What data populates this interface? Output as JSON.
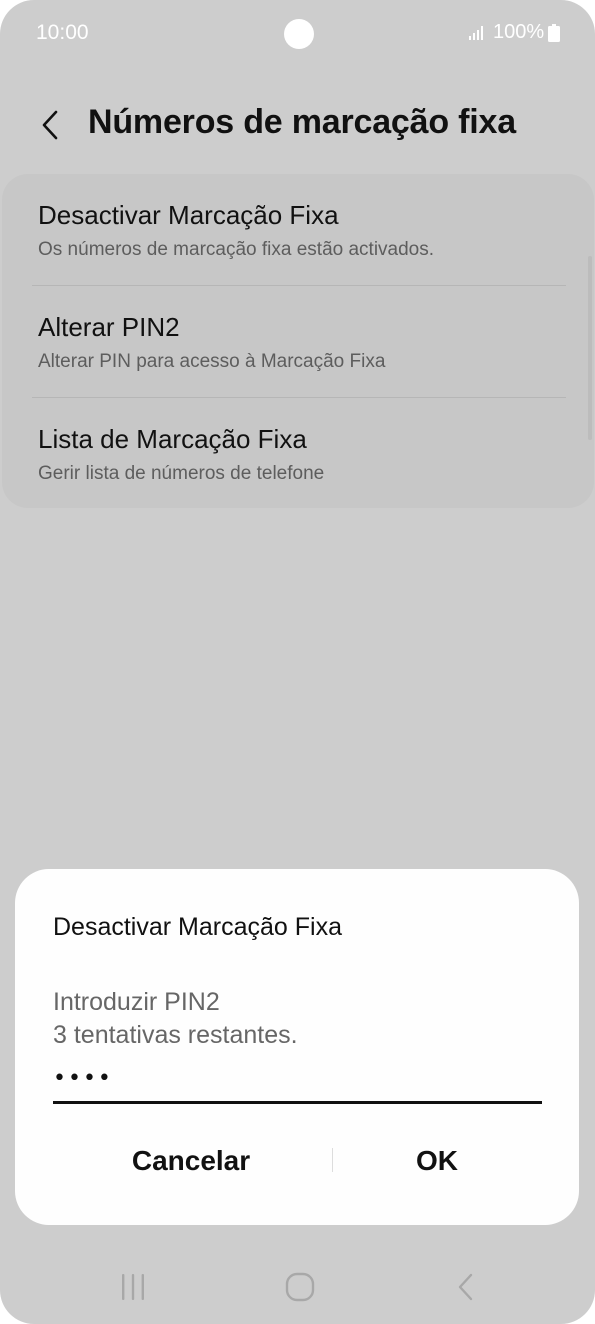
{
  "status_bar": {
    "time": "10:00",
    "battery_text": "100%"
  },
  "header": {
    "title": "Números de marcação fixa",
    "back_icon": "chevron-left-icon"
  },
  "settings": {
    "items": [
      {
        "title": "Desactivar Marcação Fixa",
        "subtitle": "Os números de marcação fixa estão activados."
      },
      {
        "title": "Alterar PIN2",
        "subtitle": "Alterar PIN para acesso à Marcação Fixa"
      },
      {
        "title": "Lista de Marcação Fixa",
        "subtitle": "Gerir lista de números de telefone"
      }
    ]
  },
  "dialog": {
    "title": "Desactivar Marcação Fixa",
    "message": "Introduzir PIN2\n3 tentativas restantes.",
    "pin_value": "••••",
    "cancel_label": "Cancelar",
    "ok_label": "OK"
  },
  "nav_bar": {
    "icons": [
      "recents-icon",
      "home-icon",
      "back-icon"
    ]
  },
  "colors": {
    "dim_background": "#cdcdcd",
    "dialog_background": "#fefefe",
    "text_primary": "#111111",
    "text_secondary": "#5d5d5d"
  }
}
